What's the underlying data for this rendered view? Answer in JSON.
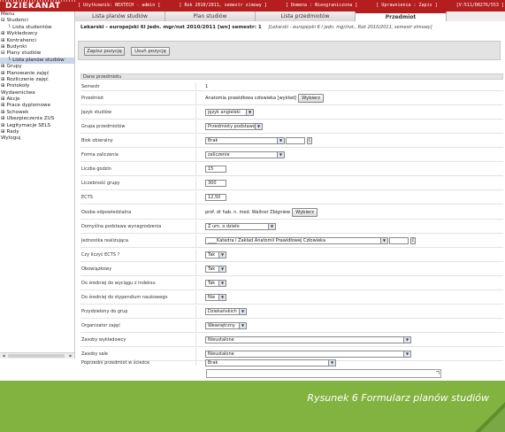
{
  "app": {
    "title": "DZIEKANAT"
  },
  "session": {
    "user": "[ Użytkownik: NEXTECH - admin ]",
    "year": "[ Rok 2010/2011, semestr zimowy ]",
    "domain": "[ Domena : Nieograniczona ]",
    "rights": "[ Uprawnienia : Zapis ]",
    "version": "[V:511/D8276/553 ]"
  },
  "tabs": [
    {
      "label": "Lista planów studiów",
      "active": false
    },
    {
      "label": "Plan studiów",
      "active": false
    },
    {
      "label": "Lista przedmiotów",
      "active": false
    },
    {
      "label": "Przedmiot",
      "active": true
    }
  ],
  "sidebar": {
    "items": [
      {
        "label": "Menu",
        "indent": 0,
        "prefix": ""
      },
      {
        "label": "Studenci",
        "indent": 0,
        "prefix": "⊟ "
      },
      {
        "label": "Lista studentów",
        "indent": 1,
        "prefix": "└ "
      },
      {
        "label": "Wykładowcy",
        "indent": 0,
        "prefix": "⊞ "
      },
      {
        "label": "Kontrahenci",
        "indent": 0,
        "prefix": "⊞ "
      },
      {
        "label": "Budynki",
        "indent": 0,
        "prefix": "⊞ "
      },
      {
        "label": "Plany studiów",
        "indent": 0,
        "prefix": "⊟ "
      },
      {
        "label": "Lista planów studiów",
        "indent": 1,
        "prefix": "└ ",
        "active": true
      },
      {
        "label": "Grupy",
        "indent": 0,
        "prefix": "⊞ "
      },
      {
        "label": "Planowanie zajęć",
        "indent": 0,
        "prefix": "⊞ "
      },
      {
        "label": "Rozliczenie zajęć",
        "indent": 0,
        "prefix": "⊞ "
      },
      {
        "label": "Protokoły",
        "indent": 0,
        "prefix": "⊞ "
      },
      {
        "label": "Wydawnictwa",
        "indent": 0,
        "prefix": "  "
      },
      {
        "label": "Akcje",
        "indent": 0,
        "prefix": "⊞ "
      },
      {
        "label": "Prace dyplomowe",
        "indent": 0,
        "prefix": "⊞ "
      },
      {
        "label": "Schowek",
        "indent": 0,
        "prefix": "⊞ "
      },
      {
        "label": "Ubezpieczenia ZUS",
        "indent": 0,
        "prefix": "⊞ "
      },
      {
        "label": "Legitymacje SELS",
        "indent": 0,
        "prefix": "⊞ "
      },
      {
        "label": "Rady",
        "indent": 0,
        "prefix": "⊞ "
      },
      {
        "label": "Wyloguj",
        "indent": 0,
        "prefix": "  "
      }
    ]
  },
  "page": {
    "title_bold": "Lekarski - europejski 6l jedn. mgr/nst 2010/2011 [wn] semestr: 1",
    "title_italic": "[Lekarski - europejski 6 l jedn. mgr/nst., Rok 2010/2011, semestr zimowy]",
    "add_button": "Zapisz pozycję",
    "remove_button": "Usuń pozycję",
    "section_header": "Dane przedmiotu"
  },
  "form": {
    "semestr": {
      "label": "Semestr",
      "value": "1"
    },
    "przedmiot": {
      "label": "Przedmiot",
      "value": "Anatomia prawidłowa człowieka [wykład]",
      "button": "Wybierz"
    },
    "jezyk": {
      "label": "Język studiów",
      "value": "język angielski"
    },
    "grupa_przedmiotow": {
      "label": "Grupa przedmiotów",
      "value": "Przedmioty podstawowe"
    },
    "blok": {
      "label": "Blok obieralny",
      "value": "Brak",
      "button": "C"
    },
    "forma": {
      "label": "Forma zaliczenia",
      "value": "zaliczenie"
    },
    "godziny": {
      "label": "Liczba godzin",
      "value": "15"
    },
    "liczebnosc": {
      "label": "Liczebność grupy",
      "value": "300"
    },
    "ects": {
      "label": "ECTS",
      "value": "12,50"
    },
    "osoba": {
      "label": "Osoba odpowiedzialna",
      "value": "prof. dr hab. n. med. Wallner Zbigniew",
      "button": "Wybierz"
    },
    "podstawa": {
      "label": "Domyślna podstawa wynagrodzenia",
      "value": "Z um. o dzieło"
    },
    "jednostka": {
      "label": "Jednostka realizująca",
      "value": "____Katedra i Zakład Anatomii Prawidłowej Człowieka",
      "button": "C"
    },
    "czy_ects": {
      "label": "Czy liczyć ECTS ?",
      "value": "Tak"
    },
    "obowiazkowy": {
      "label": "Obowiązkowy",
      "value": "Tak"
    },
    "srednia_wyciag": {
      "label": "Do średniej do wyciągu z indeksu",
      "value": "Tak"
    },
    "srednia_stypendium": {
      "label": "Do średniej do stypendium naukowego",
      "value": "Nie"
    },
    "przydzielony": {
      "label": "Przydzielony do grup",
      "value": "Dziekańskich"
    },
    "organizator": {
      "label": "Organizator zajęć",
      "value": "Wewnętrzny"
    },
    "zasoby_wykladowcy": {
      "label": "Zasoby wykładowcy",
      "value": "Nieustalone"
    },
    "zasoby_sale": {
      "label": "Zasoby sale",
      "value": "Nieustalone"
    },
    "poprzedni": {
      "label": "Poprzedni przedmiot w ścieżce",
      "value": "Brak"
    }
  },
  "caption": "Rysunek 6 Formularz planów studiów",
  "colors": {
    "brand": "#b51e1e",
    "footer": "#82b341",
    "selected": "#c9d7ea"
  }
}
